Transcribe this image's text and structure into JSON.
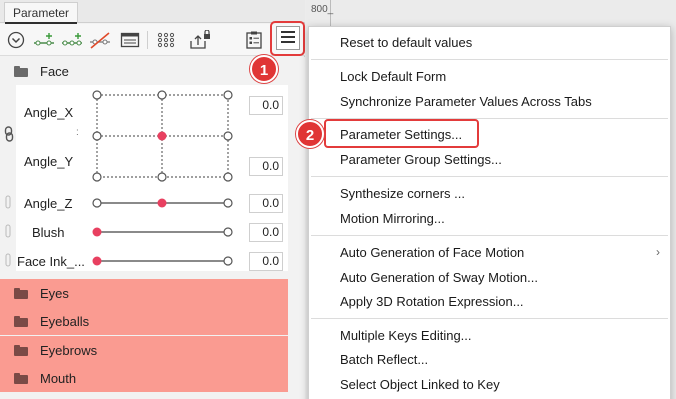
{
  "tab": {
    "label": "Parameter"
  },
  "ruler": {
    "label": "800_"
  },
  "toolbar": {
    "icons": [
      "chevron-circle-icon",
      "add-key-icon",
      "add-keys-icon",
      "delete-key-icon",
      "form-editor-icon",
      "grid-dots-icon",
      "export-lock-icon",
      "clipboard-list-icon",
      "hamburger-menu-icon"
    ]
  },
  "groups": {
    "face": "Face",
    "eyes": "Eyes",
    "eyeballs": "Eyeballs",
    "eyebrows": "Eyebrows",
    "mouth": "Mouth"
  },
  "params": {
    "angle_x": {
      "label": "Angle_X",
      "value": "0.0"
    },
    "angle_y": {
      "label": "Angle_Y",
      "value": "0.0"
    },
    "angle_z": {
      "label": "Angle_Z",
      "value": "0.0"
    },
    "blush": {
      "label": "Blush",
      "value": "0.0"
    },
    "face_ink": {
      "label": "Face Ink_...",
      "value": "0.0"
    }
  },
  "badges": {
    "one": "1",
    "two": "2"
  },
  "colors": {
    "accent_red": "#e33b3b",
    "highlight_row": "#fa9b91",
    "slider_point": "#e84060"
  },
  "menu": {
    "reset": "Reset to default values",
    "lock_form": "Lock Default Form",
    "sync": "Synchronize Parameter Values Across Tabs",
    "param_settings": "Parameter Settings...",
    "group_settings": "Parameter Group Settings...",
    "synth_corners": "Synthesize corners ...",
    "mirroring": "Motion Mirroring...",
    "auto_face": "Auto Generation of Face Motion",
    "auto_sway": "Auto Generation of Sway Motion...",
    "apply_3d": "Apply 3D Rotation Expression...",
    "multi_keys": "Multiple Keys Editing...",
    "batch": "Batch Reflect...",
    "select_linked": "Select Object Linked to Key",
    "submenu_arrow": "›"
  }
}
